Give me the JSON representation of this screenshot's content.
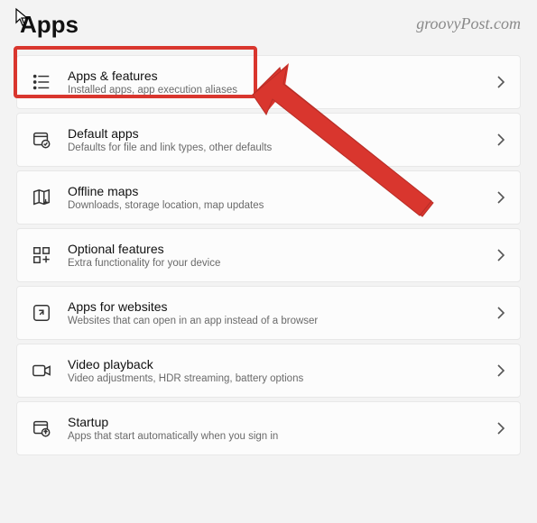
{
  "header": {
    "title": "Apps",
    "watermark": "groovyPost.com"
  },
  "items": [
    {
      "icon": "apps-features",
      "title": "Apps & features",
      "subtitle": "Installed apps, app execution aliases"
    },
    {
      "icon": "default-apps",
      "title": "Default apps",
      "subtitle": "Defaults for file and link types, other defaults"
    },
    {
      "icon": "offline-maps",
      "title": "Offline maps",
      "subtitle": "Downloads, storage location, map updates"
    },
    {
      "icon": "optional-features",
      "title": "Optional features",
      "subtitle": "Extra functionality for your device"
    },
    {
      "icon": "apps-websites",
      "title": "Apps for websites",
      "subtitle": "Websites that can open in an app instead of a browser"
    },
    {
      "icon": "video-playback",
      "title": "Video playback",
      "subtitle": "Video adjustments, HDR streaming, battery options"
    },
    {
      "icon": "startup",
      "title": "Startup",
      "subtitle": "Apps that start automatically when you sign in"
    }
  ],
  "annotation": {
    "highlight_color": "#d9362e"
  }
}
